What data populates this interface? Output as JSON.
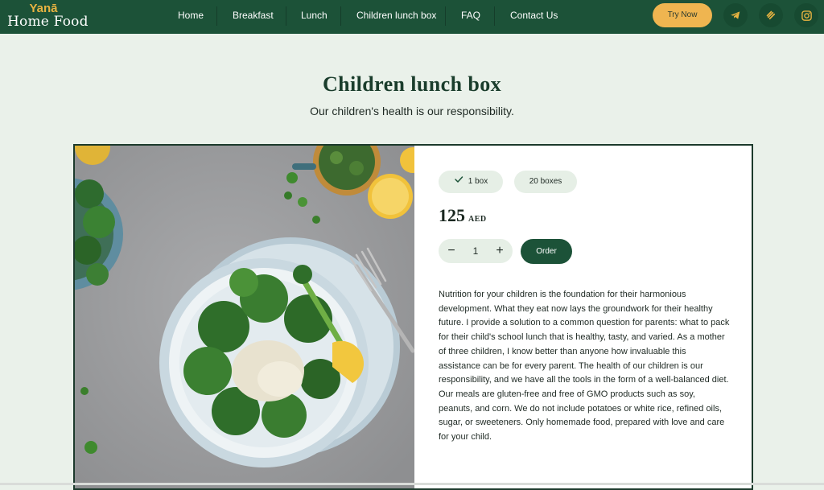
{
  "brand": {
    "top": "Yanā",
    "bottom": "Home Food"
  },
  "nav": {
    "items": [
      {
        "label": "Home"
      },
      {
        "label": "Breakfast"
      },
      {
        "label": "Lunch"
      },
      {
        "label": "Children lunch box"
      },
      {
        "label": "FAQ"
      },
      {
        "label": "Contact Us"
      }
    ],
    "cta_label": "Try Now",
    "icons": [
      "telegram-icon",
      "deliveroo-icon",
      "instagram-icon"
    ]
  },
  "page": {
    "title": "Children lunch box",
    "subtitle": "Our children's health is our responsibility."
  },
  "product": {
    "options": [
      {
        "label": "1 box",
        "selected": true
      },
      {
        "label": "20 boxes",
        "selected": false
      }
    ],
    "price": "125",
    "currency": "AED",
    "quantity": "1",
    "decrement_symbol": "−",
    "increment_symbol": "+",
    "order_label": "Order",
    "description": "Nutrition for your children is the foundation for their harmonious development. What they eat now lays the groundwork for their healthy future. I provide a solution to a common question for parents: what to pack for their child's school lunch that is healthy, tasty, and varied. As a mother of three children, I know better than anyone how invaluable this assistance can be for every parent. The health of our children is our responsibility, and we have all the tools in the form of a well-balanced diet. Our meals are gluten-free and free of GMO products such as soy, peanuts, and corn. We do not include potatoes or white rice, refined oils, sugar, or sweeteners. Only homemade food, prepared with love and care for your child."
  },
  "colors": {
    "header_bg": "#1c5238",
    "accent": "#efb550",
    "page_bg": "#eaf1ea",
    "pill_bg": "#e6efe6"
  }
}
